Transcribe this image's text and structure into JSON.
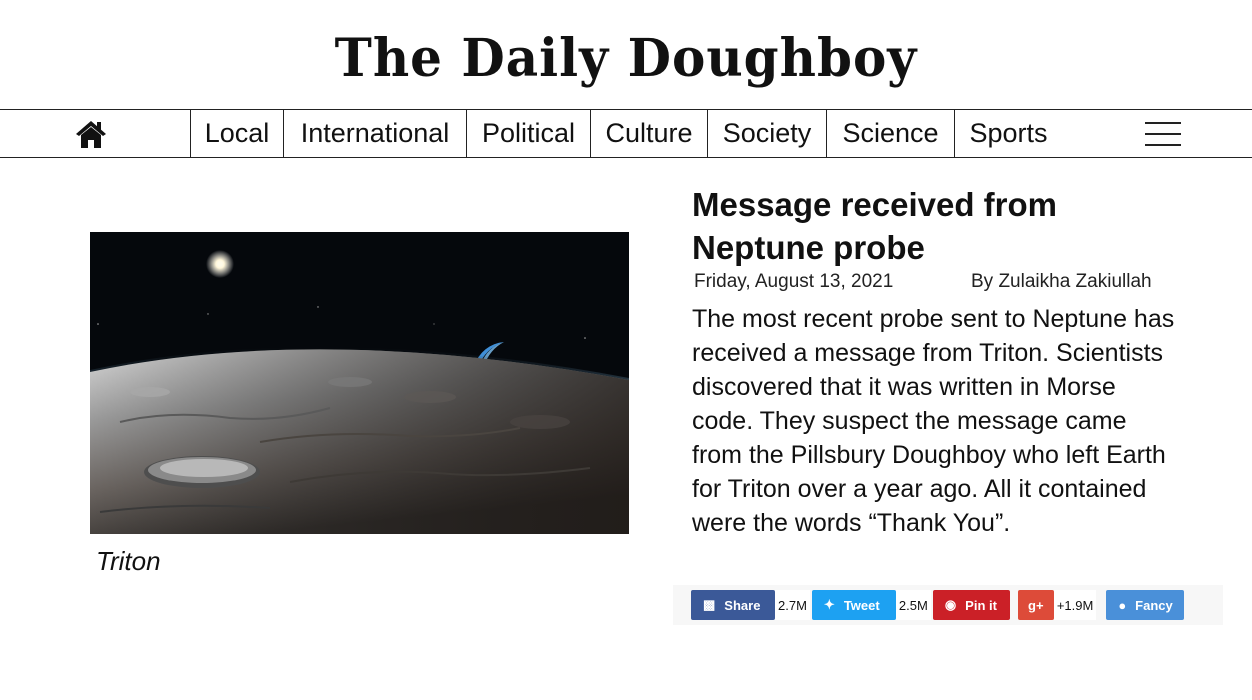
{
  "masthead": {
    "title": "The Daily Doughboy"
  },
  "nav": {
    "home_icon": "home-icon",
    "items": [
      {
        "label": "Local"
      },
      {
        "label": "International"
      },
      {
        "label": "Political"
      },
      {
        "label": "Culture"
      },
      {
        "label": "Society"
      },
      {
        "label": "Science"
      },
      {
        "label": "Sports"
      }
    ],
    "menu_icon": "hamburger-menu-icon"
  },
  "article": {
    "image_caption": "Triton",
    "headline_line1": "Message received from",
    "headline_line2": "Neptune probe",
    "date": "Friday, August 13, 2021",
    "byline": "By Zulaikha Zakiullah",
    "body": "The most recent probe sent to Neptune has received a message from Triton. Scientists discovered that it was written in Morse code. They suspect the message came from the Pillsbury Doughboy who left Earth for Triton over a year ago. All it contained were the words “Thank You”."
  },
  "share": {
    "facebook": {
      "label": "Share",
      "count": "2.7M",
      "color": "#3b5998",
      "icon": "facebook-icon"
    },
    "twitter": {
      "label": "Tweet",
      "count": "2.5M",
      "color": "#1da1f2",
      "icon": "twitter-icon"
    },
    "pinterest": {
      "label": "Pin it",
      "color": "#cb2027",
      "icon": "pinterest-icon"
    },
    "googleplus": {
      "glyph": "g+",
      "count": "+1.9M",
      "color": "#dd4b39",
      "icon": "google-plus-icon"
    },
    "fancy": {
      "label": "Fancy",
      "color": "#4a90d9",
      "icon": "fancy-icon"
    }
  }
}
